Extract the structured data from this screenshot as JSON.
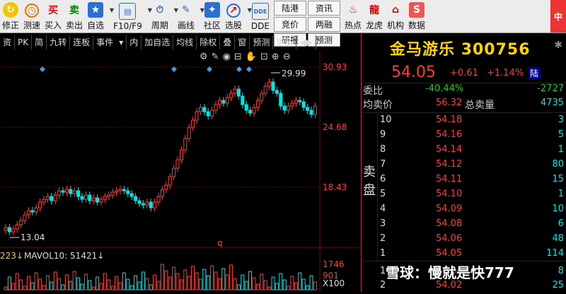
{
  "toolbar": {
    "buttons": [
      {
        "label": "修正",
        "icon": "refresh-icon"
      },
      {
        "label": "测速",
        "icon": "speed-icon"
      },
      {
        "label": "买入",
        "icon": "buy-icon",
        "glyph": "买"
      },
      {
        "label": "卖出",
        "icon": "sell-icon",
        "glyph": "卖"
      },
      {
        "label": "自选",
        "icon": "star-icon"
      },
      {
        "label": "F10/F9",
        "icon": "f10-icon"
      },
      {
        "label": "周期",
        "icon": "cycle-icon"
      },
      {
        "label": "画线",
        "icon": "pen-icon"
      },
      {
        "label": "社区",
        "icon": "community-icon"
      },
      {
        "label": "选股",
        "icon": "stock-pick-icon"
      },
      {
        "label": "DDE",
        "icon": "dde-icon"
      }
    ],
    "grid": [
      "陆港",
      "资讯",
      "竞价",
      "两融",
      "研报",
      "预测"
    ],
    "apps": [
      {
        "label": "热点",
        "icon": "hot-icon"
      },
      {
        "label": "龙虎",
        "icon": "dragon-icon"
      },
      {
        "label": "机构",
        "icon": "institution-icon"
      },
      {
        "label": "数据",
        "icon": "data-icon"
      }
    ]
  },
  "tabs": [
    "资",
    "PK",
    "简",
    "九转",
    "连板",
    "事件",
    "▾",
    "内",
    "加自选",
    "均线",
    "除权",
    "叠",
    "窗",
    "预测",
    "更多",
    "◀▶"
  ],
  "chart": {
    "price_labels": [
      "30.93",
      "24.68",
      "18.43"
    ],
    "high_marker": "29.99",
    "low_marker": "13.04",
    "q_marker": "q",
    "volume": {
      "left_label": "223↓",
      "mavol": "MAVOL10: 51421↓",
      "right_labels": [
        "1746",
        "901",
        "X100"
      ]
    }
  },
  "quote": {
    "name": "金马游乐",
    "code": "300756",
    "price": "54.05",
    "change": "+0.61",
    "change_pct": "+1.14%",
    "tag": "陆",
    "weibi_label": "委比",
    "weibi_pct": "-40.44%",
    "weibi_val": "-2727",
    "avg_label": "均卖价",
    "avg_val": "56.32",
    "total_label": "总卖量",
    "total_val": "4735",
    "sell_label": "卖盘",
    "sell": [
      {
        "lv": "10",
        "p": "54.18",
        "v": "3"
      },
      {
        "lv": "9",
        "p": "54.16",
        "v": "5"
      },
      {
        "lv": "8",
        "p": "54.14",
        "v": "1"
      },
      {
        "lv": "7",
        "p": "54.12",
        "v": "80"
      },
      {
        "lv": "6",
        "p": "54.11",
        "v": "15"
      },
      {
        "lv": "5",
        "p": "54.10",
        "v": "1"
      },
      {
        "lv": "4",
        "p": "54.09",
        "v": "10"
      },
      {
        "lv": "3",
        "p": "54.08",
        "v": "6"
      },
      {
        "lv": "2",
        "p": "54.06",
        "v": "48"
      },
      {
        "lv": "1",
        "p": "54.05",
        "v": "114"
      }
    ],
    "buy": [
      {
        "lv": "1",
        "p": "54.04",
        "v": "8"
      },
      {
        "lv": "2",
        "p": "54.02",
        "v": "25"
      }
    ]
  },
  "watermark": "雪球：慢就是快777"
}
